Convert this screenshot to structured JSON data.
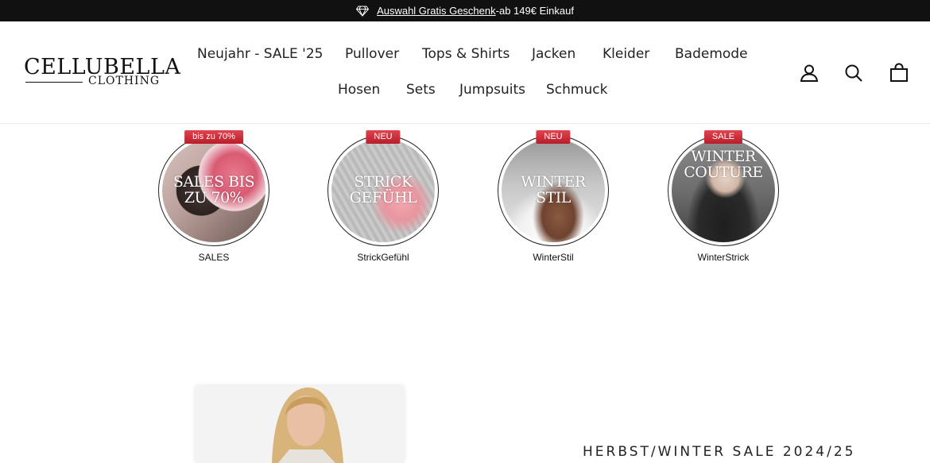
{
  "announcement": {
    "link_text": "Auswahl Gratis Geschenk",
    "suffix": "-ab 149€ Einkauf",
    "icon": "diamond-icon"
  },
  "brand": {
    "name": "CELLUBELLA",
    "subline": "CLOTHING"
  },
  "nav": {
    "items": [
      "Neujahr - SALE '25",
      "Pullover",
      "Tops & Shirts",
      "Jacken",
      "Kleider",
      "Bademode",
      "Hosen",
      "Sets",
      "Jumpsuits",
      "Schmuck"
    ]
  },
  "header_icons": {
    "account": "user-icon",
    "search": "search-icon",
    "cart": "shopping-bag-icon"
  },
  "categories": [
    {
      "badge": "bis zu 70%",
      "image_text": "SALES BIS ZU 70%",
      "label": "SALES"
    },
    {
      "badge": "NEU",
      "image_text": "STRICK GEFÜHL",
      "label": "StrickGefühl"
    },
    {
      "badge": "NEU",
      "image_text": "WINTER STIL",
      "label": "WinterStil"
    },
    {
      "badge": "SALE",
      "image_text": "WINTER COUTURE",
      "label": "WinterStrick"
    }
  ],
  "promo": {
    "heading": "HERBST/WINTER SALE 2024/25"
  },
  "colors": {
    "announcement_bg": "#111111",
    "badge_red": "#c8252f",
    "text": "#111111"
  }
}
